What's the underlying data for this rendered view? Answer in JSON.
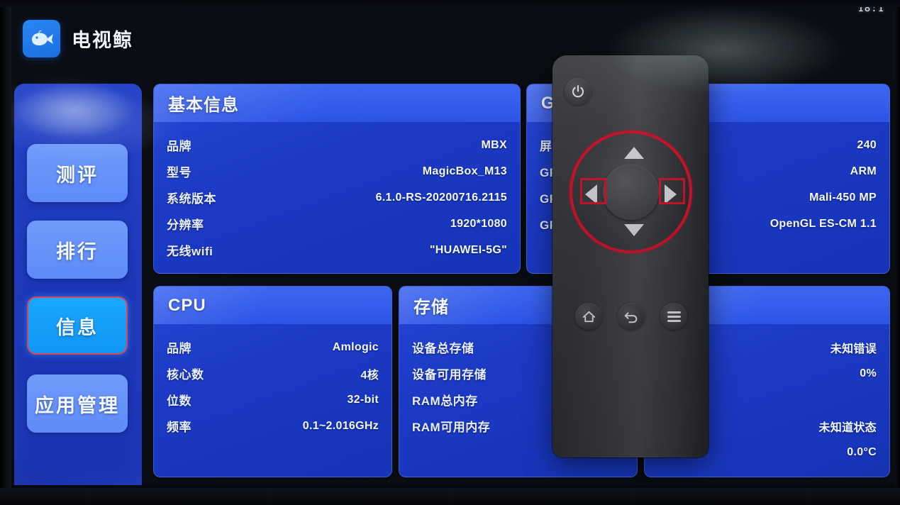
{
  "status": {
    "clock": "18:1"
  },
  "header": {
    "app_title": "电视鲸",
    "logo_icon": "whale-icon"
  },
  "sidebar": {
    "items": [
      {
        "label": "测评",
        "active": false
      },
      {
        "label": "排行",
        "active": false
      },
      {
        "label": "信息",
        "active": true
      },
      {
        "label": "应用管理",
        "active": false
      }
    ]
  },
  "cards": {
    "basic": {
      "title": "基本信息",
      "rows": [
        {
          "key": "品牌",
          "value": "MBX"
        },
        {
          "key": "型号",
          "value": "MagicBox_M13"
        },
        {
          "key": "系统版本",
          "value": "6.1.0-RS-20200716.2115"
        },
        {
          "key": "分辨率",
          "value": "1920*1080"
        },
        {
          "key": "无线wifi",
          "value": "\"HUAWEI-5G\""
        }
      ]
    },
    "gpu": {
      "title": "GPU",
      "rows": [
        {
          "key": "屏幕密度",
          "value": "240"
        },
        {
          "key": "GPU供应商",
          "value": "ARM"
        },
        {
          "key": "GPU渲染器",
          "value": "Mali-450 MP"
        },
        {
          "key": "GPU版本",
          "value": "OpenGL ES-CM 1.1"
        }
      ]
    },
    "cpu": {
      "title": "CPU",
      "rows": [
        {
          "key": "品牌",
          "value": "Amlogic"
        },
        {
          "key": "核心数",
          "value": "4核"
        },
        {
          "key": "位数",
          "value": "32-bit"
        },
        {
          "key": "频率",
          "value": "0.1~2.016GHz"
        }
      ]
    },
    "storage": {
      "title": "存储",
      "rows": [
        {
          "key": "设备总存储",
          "value": ""
        },
        {
          "key": "设备可用存储",
          "value": ""
        },
        {
          "key": "RAM总内存",
          "value": ""
        },
        {
          "key": "RAM可用内存",
          "value": ""
        }
      ]
    },
    "system": {
      "title": "",
      "rows": [
        {
          "key": "",
          "value": "未知错误"
        },
        {
          "key": "",
          "value": "0%"
        },
        {
          "key": "",
          "value": ""
        },
        {
          "key": "",
          "value": "未知道状态"
        },
        {
          "key": "",
          "value": "0.0°C"
        }
      ]
    }
  },
  "remote": {
    "power_icon": "power-icon",
    "dpad": {
      "up_icon": "arrow-up-icon",
      "down_icon": "arrow-down-icon",
      "left_icon": "arrow-left-icon",
      "right_icon": "arrow-right-icon",
      "center_icon": "ok-button"
    },
    "buttons": [
      {
        "icon": "home-icon"
      },
      {
        "icon": "back-icon"
      },
      {
        "icon": "menu-icon"
      }
    ],
    "highlight_color": "#c6142a"
  },
  "colors": {
    "panel_blue": "#1c3ac4",
    "header_blue": "#2d53e6",
    "nav_blue": "#5e8bf8",
    "nav_active": "#0f96f5",
    "accent_red": "#e0405a"
  }
}
